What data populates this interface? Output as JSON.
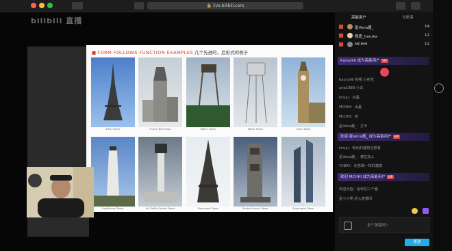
{
  "browser": {
    "url": "live.bilibili.com"
  },
  "app": {
    "logo": "bilibili 直播"
  },
  "slide": {
    "title_en": "FORM FOLLOWS FUNCTION EXAMPLES",
    "title_cn": " 几个先进的，后形式的例子",
    "buildings": [
      {
        "cap": "Eiffel Tower"
      },
      {
        "cap": "Church Bell Tower"
      },
      {
        "cap": "Watch Tower"
      },
      {
        "cap": "Water Tower"
      },
      {
        "cap": "Clock Tower"
      },
      {
        "cap": "Lighthouse Tower"
      },
      {
        "cap": "Air Traffic Control Tower"
      },
      {
        "cap": "Monument Tower"
      },
      {
        "cap": "Rocket Launch Tower"
      },
      {
        "cap": "Skyscraper Tower"
      }
    ]
  },
  "chat": {
    "tabs": [
      "高能用户",
      "大航海"
    ],
    "ranks": [
      {
        "name": "星Vena酱_",
        "count": "14"
      },
      {
        "name": "佩奇_haruka",
        "count": "12"
      },
      {
        "name": "MCHHI",
        "count": "12"
      }
    ],
    "banner1": "Kassy96 成为高能用户",
    "lines": [
      {
        "text": "Kassy96 投喂 小花花"
      },
      {
        "text": "aria1988 小白"
      },
      {
        "text": "kimju：水晶"
      },
      {
        "text": "MCHHI：水晶"
      },
      {
        "text": "MCHHI：快"
      },
      {
        "text": "星Vena酱_：打卡"
      }
    ],
    "banner2": "欢迎 星Vena酱_ 成为高能用户",
    "lines2": [
      {
        "text": "kimju：现代的建筑也很有"
      },
      {
        "text": "星Vena酱_：泰拉加入"
      },
      {
        "text": "YXBAY：纪念碑一样的建筑"
      }
    ],
    "banner3": "欢迎 MCHHI 成为高能用户",
    "lines3": [
      {
        "text": "欢迎光临：给你们三个看"
      },
      {
        "text": "星小小明 进入直播间"
      }
    ],
    "input_placeholder": "发个弹幕呗~",
    "send_label": "发送"
  }
}
